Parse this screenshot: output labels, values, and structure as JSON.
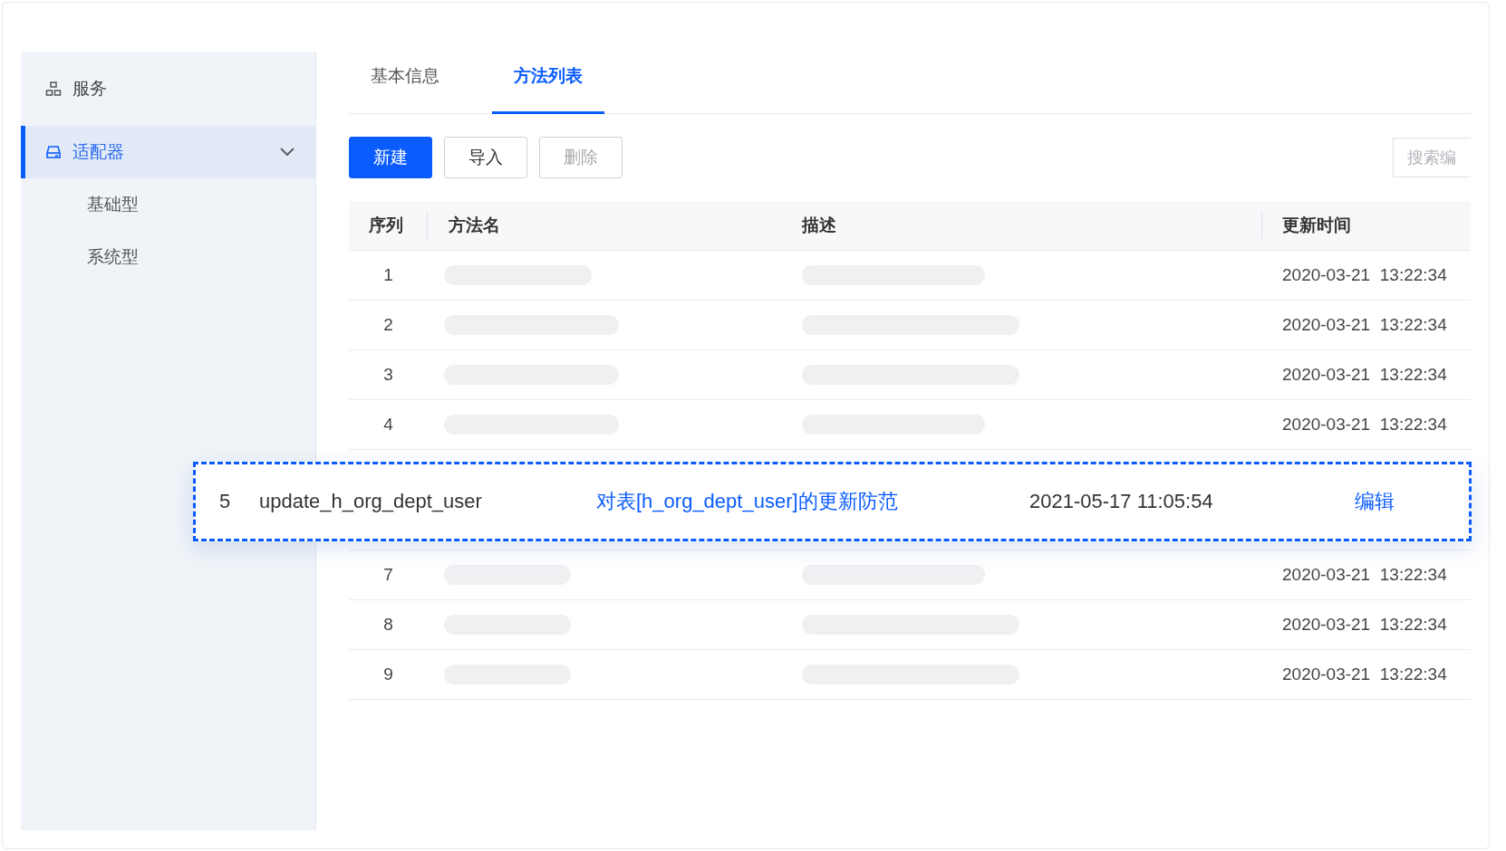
{
  "sidebar": {
    "items": [
      {
        "label": "服务",
        "selected": false
      },
      {
        "label": "适配器",
        "selected": true,
        "expanded": true,
        "children": [
          {
            "label": "基础型",
            "selected": false
          },
          {
            "label": "系统型",
            "selected": false
          }
        ]
      }
    ]
  },
  "tabs": [
    {
      "label": "基本信息",
      "selected": false
    },
    {
      "label": "方法列表",
      "selected": true
    }
  ],
  "buttons": [
    {
      "label": "新建",
      "kind": "primary",
      "disabled": false
    },
    {
      "label": "导入",
      "kind": "default",
      "disabled": false
    },
    {
      "label": "删除",
      "kind": "default",
      "disabled": true
    }
  ],
  "search": {
    "placeholder": "搜索编"
  },
  "table": {
    "columns": [
      "序列",
      "方法名",
      "描述",
      "更新时间"
    ],
    "rows": [
      {
        "index": "1",
        "updated": "2020-03-21  13:22:34"
      },
      {
        "index": "2",
        "updated": "2020-03-21  13:22:34"
      },
      {
        "index": "3",
        "updated": "2020-03-21  13:22:34"
      },
      {
        "index": "4",
        "updated": "2020-03-21  13:22:34"
      },
      {
        "index": "7",
        "updated": "2020-03-21  13:22:34"
      },
      {
        "index": "8",
        "updated": "2020-03-21  13:22:34"
      },
      {
        "index": "9",
        "updated": "2020-03-21  13:22:34"
      }
    ]
  },
  "highlighted_row": {
    "index": "5",
    "name": "update_h_org_dept_user",
    "description": "对表[h_org_dept_user]的更新防范",
    "updated": "2021-05-17 11:05:54",
    "action": "编辑"
  }
}
